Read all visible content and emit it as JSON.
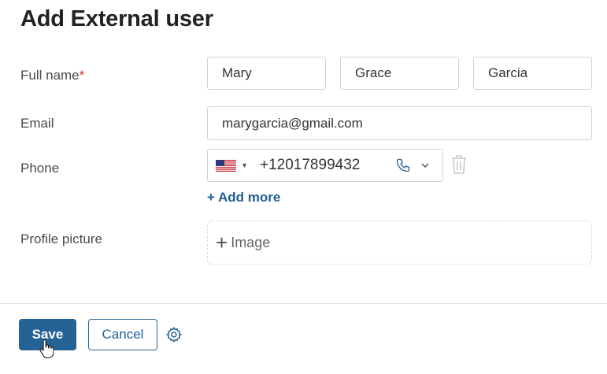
{
  "page": {
    "title": "Add External user"
  },
  "form": {
    "full_name": {
      "label": "Full name",
      "required_mark": "*",
      "first": "Mary",
      "middle": "Grace",
      "last": "Garcia"
    },
    "email": {
      "label": "Email",
      "value": "marygarcia@gmail.com"
    },
    "phone": {
      "label": "Phone",
      "country_flag": "us-flag-icon",
      "value": "+12017899432",
      "type_icon": "phone-icon",
      "add_more": "+ Add more"
    },
    "profile_picture": {
      "label": "Profile picture",
      "add_image": "Image"
    }
  },
  "footer": {
    "save_label": "Save",
    "cancel_label": "Cancel"
  },
  "colors": {
    "primary": "#256295",
    "link": "#1f5f96",
    "required": "#d9262c",
    "border": "#cfd3d8"
  }
}
